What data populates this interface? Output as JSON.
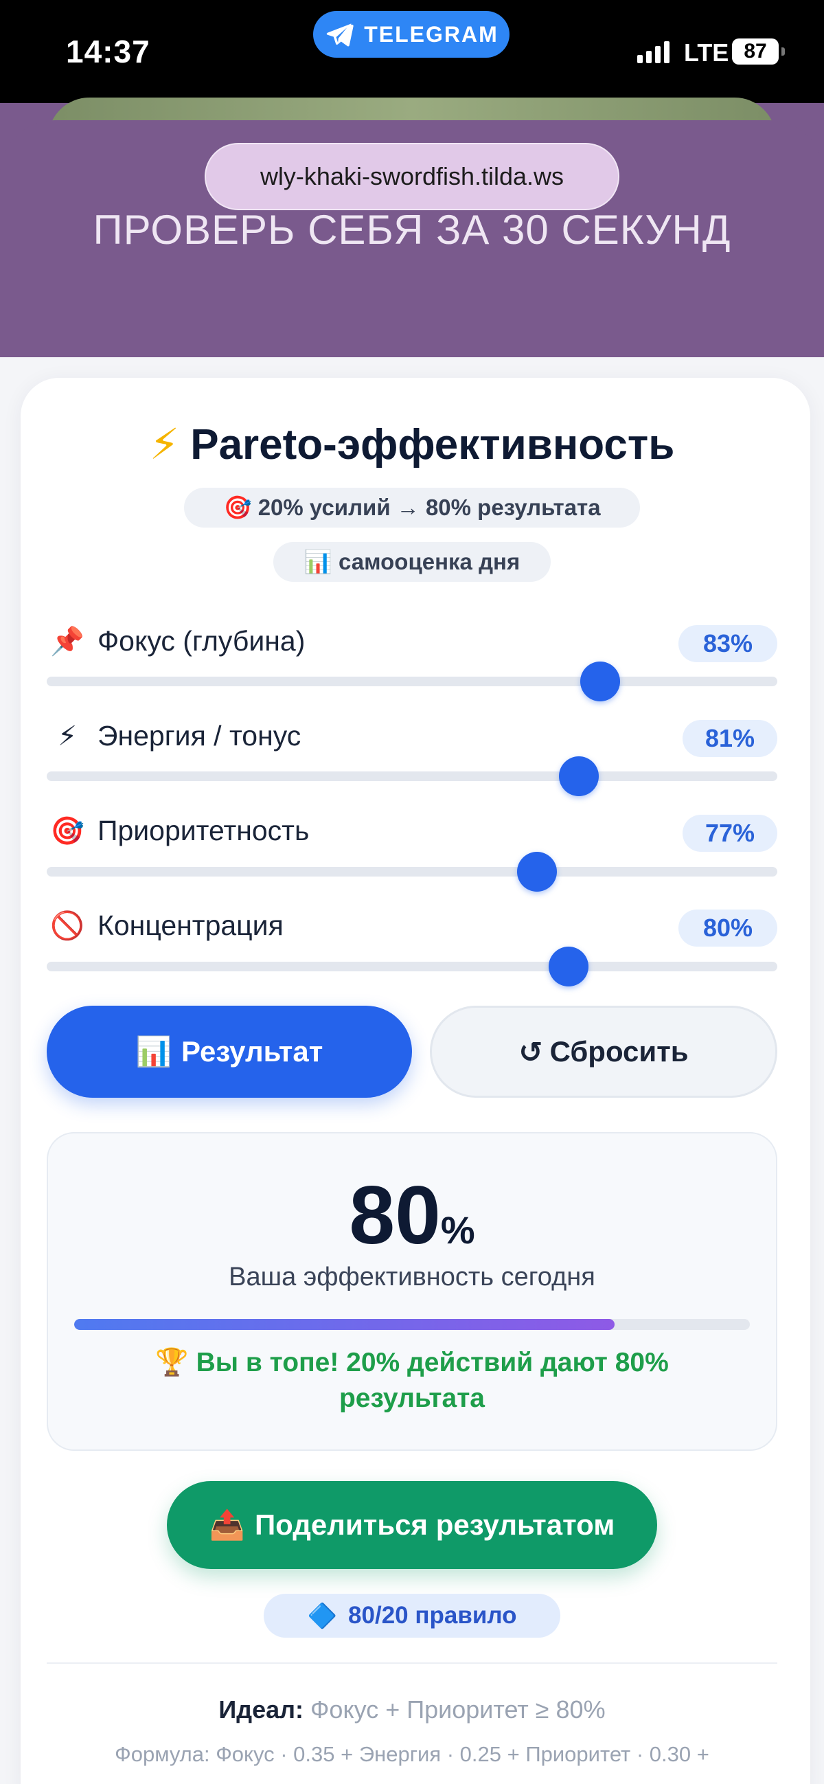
{
  "status_bar": {
    "time": "14:37",
    "center_label": "TELEGRAM",
    "network": "LTE",
    "battery": "87"
  },
  "browser": {
    "url": "wly-khaki-swordfish.tilda.ws"
  },
  "hero": {
    "title": "ПРОВЕРЬ СЕБЯ ЗА 30 СЕКУНД"
  },
  "card": {
    "title_icon": "⚡",
    "title": "Pareto-эффективность",
    "chip1": "🎯 20% усилий → 80% результата",
    "chip2": "📊 самооценка дня",
    "sliders": [
      {
        "icon": "📌",
        "label": "Фокус (глубина)",
        "value": 83,
        "display": "83%"
      },
      {
        "icon": "⚡",
        "label": "Энергия / тонус",
        "value": 81,
        "display": "81%"
      },
      {
        "icon": "🎯",
        "label": "Приоритетность",
        "value": 77,
        "display": "77%"
      },
      {
        "icon": "🚫",
        "label": "Концентрация",
        "value": 80,
        "display": "80%"
      }
    ],
    "result_button": {
      "icon": "📊",
      "label": "Результат"
    },
    "reset_button": {
      "icon": "↺",
      "label": "Сбросить"
    },
    "result": {
      "value": "80",
      "unit": "%",
      "caption": "Ваша эффективность сегодня",
      "progress": 0.8,
      "message": "🏆 Вы в топе! 20% действий дают 80% результата"
    },
    "share_button": {
      "icon": "📤",
      "label": "Поделиться результатом"
    },
    "rule_chip": {
      "icon": "🔷",
      "label": "80/20 правило"
    },
    "ideal": {
      "label": "Идеал:",
      "text": "Фокус + Приоритет ≥ 80%"
    },
    "formula": "Формула: Фокус · 0.35 + Энергия · 0.25 + Приоритет · 0.30 +"
  },
  "colors": {
    "accent": "#2563eb",
    "share": "#0f9a68",
    "success_text": "#1e9e4a",
    "header_bg": "#7a5a8d"
  }
}
